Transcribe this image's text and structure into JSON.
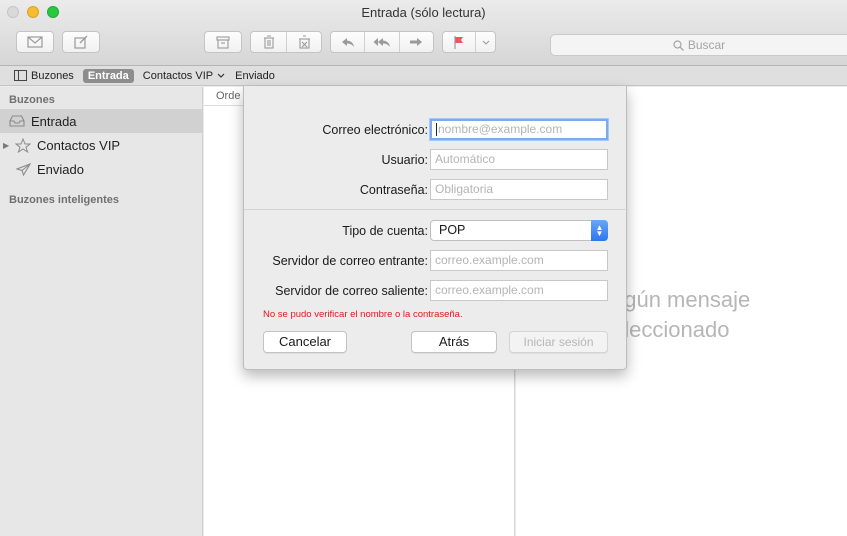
{
  "window": {
    "title": "Entrada (sólo lectura)"
  },
  "toolbar": {
    "icons": [
      "compose-mail-icon",
      "new-note-icon",
      "archive-icon",
      "trash-icon",
      "junk-icon",
      "reply-icon",
      "reply-all-icon",
      "forward-icon",
      "flag-icon",
      "chevron-down-icon"
    ],
    "flag_color": "#f05561"
  },
  "search": {
    "placeholder": "Buscar"
  },
  "favorites": {
    "mailboxes": "Buzones",
    "inbox": "Entrada",
    "vip": "Contactos VIP",
    "sent": "Enviado"
  },
  "sidebar": {
    "header": "Buzones",
    "items": [
      {
        "label": "Entrada",
        "icon": "inbox-tray-icon",
        "selected": true
      },
      {
        "label": "Contactos VIP",
        "icon": "star-icon",
        "selected": false
      },
      {
        "label": "Enviado",
        "icon": "paper-plane-icon",
        "selected": false
      }
    ],
    "smart_header": "Buzones inteligentes"
  },
  "message_list": {
    "sort_label": "Orde"
  },
  "viewer": {
    "line1": "ngún mensaje",
    "line2": "eleccionado"
  },
  "sheet": {
    "email_label": "Correo electrónico:",
    "email_placeholder": "nombre@example.com",
    "user_label": "Usuario:",
    "user_placeholder": "Automático",
    "password_label": "Contraseña:",
    "password_placeholder": "Obligatoria",
    "account_type_label": "Tipo de cuenta:",
    "account_type_value": "POP",
    "incoming_label": "Servidor de correo entrante:",
    "incoming_placeholder": "correo.example.com",
    "outgoing_label": "Servidor de correo saliente:",
    "outgoing_placeholder": "correo.example.com",
    "error": "No se pudo verificar el nombre o la contraseña.",
    "cancel": "Cancelar",
    "back": "Atrás",
    "sign_in": "Iniciar sesión"
  }
}
